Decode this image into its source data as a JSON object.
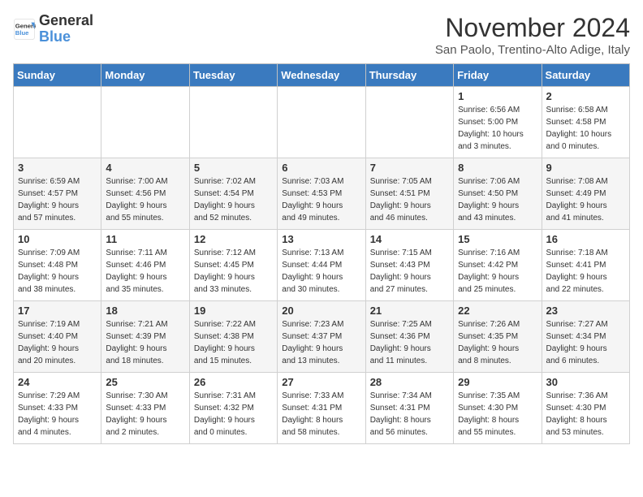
{
  "logo": {
    "line1": "General",
    "line2": "Blue"
  },
  "title": "November 2024",
  "subtitle": "San Paolo, Trentino-Alto Adige, Italy",
  "headers": [
    "Sunday",
    "Monday",
    "Tuesday",
    "Wednesday",
    "Thursday",
    "Friday",
    "Saturday"
  ],
  "weeks": [
    [
      {
        "day": "",
        "info": ""
      },
      {
        "day": "",
        "info": ""
      },
      {
        "day": "",
        "info": ""
      },
      {
        "day": "",
        "info": ""
      },
      {
        "day": "",
        "info": ""
      },
      {
        "day": "1",
        "info": "Sunrise: 6:56 AM\nSunset: 5:00 PM\nDaylight: 10 hours\nand 3 minutes."
      },
      {
        "day": "2",
        "info": "Sunrise: 6:58 AM\nSunset: 4:58 PM\nDaylight: 10 hours\nand 0 minutes."
      }
    ],
    [
      {
        "day": "3",
        "info": "Sunrise: 6:59 AM\nSunset: 4:57 PM\nDaylight: 9 hours\nand 57 minutes."
      },
      {
        "day": "4",
        "info": "Sunrise: 7:00 AM\nSunset: 4:56 PM\nDaylight: 9 hours\nand 55 minutes."
      },
      {
        "day": "5",
        "info": "Sunrise: 7:02 AM\nSunset: 4:54 PM\nDaylight: 9 hours\nand 52 minutes."
      },
      {
        "day": "6",
        "info": "Sunrise: 7:03 AM\nSunset: 4:53 PM\nDaylight: 9 hours\nand 49 minutes."
      },
      {
        "day": "7",
        "info": "Sunrise: 7:05 AM\nSunset: 4:51 PM\nDaylight: 9 hours\nand 46 minutes."
      },
      {
        "day": "8",
        "info": "Sunrise: 7:06 AM\nSunset: 4:50 PM\nDaylight: 9 hours\nand 43 minutes."
      },
      {
        "day": "9",
        "info": "Sunrise: 7:08 AM\nSunset: 4:49 PM\nDaylight: 9 hours\nand 41 minutes."
      }
    ],
    [
      {
        "day": "10",
        "info": "Sunrise: 7:09 AM\nSunset: 4:48 PM\nDaylight: 9 hours\nand 38 minutes."
      },
      {
        "day": "11",
        "info": "Sunrise: 7:11 AM\nSunset: 4:46 PM\nDaylight: 9 hours\nand 35 minutes."
      },
      {
        "day": "12",
        "info": "Sunrise: 7:12 AM\nSunset: 4:45 PM\nDaylight: 9 hours\nand 33 minutes."
      },
      {
        "day": "13",
        "info": "Sunrise: 7:13 AM\nSunset: 4:44 PM\nDaylight: 9 hours\nand 30 minutes."
      },
      {
        "day": "14",
        "info": "Sunrise: 7:15 AM\nSunset: 4:43 PM\nDaylight: 9 hours\nand 27 minutes."
      },
      {
        "day": "15",
        "info": "Sunrise: 7:16 AM\nSunset: 4:42 PM\nDaylight: 9 hours\nand 25 minutes."
      },
      {
        "day": "16",
        "info": "Sunrise: 7:18 AM\nSunset: 4:41 PM\nDaylight: 9 hours\nand 22 minutes."
      }
    ],
    [
      {
        "day": "17",
        "info": "Sunrise: 7:19 AM\nSunset: 4:40 PM\nDaylight: 9 hours\nand 20 minutes."
      },
      {
        "day": "18",
        "info": "Sunrise: 7:21 AM\nSunset: 4:39 PM\nDaylight: 9 hours\nand 18 minutes."
      },
      {
        "day": "19",
        "info": "Sunrise: 7:22 AM\nSunset: 4:38 PM\nDaylight: 9 hours\nand 15 minutes."
      },
      {
        "day": "20",
        "info": "Sunrise: 7:23 AM\nSunset: 4:37 PM\nDaylight: 9 hours\nand 13 minutes."
      },
      {
        "day": "21",
        "info": "Sunrise: 7:25 AM\nSunset: 4:36 PM\nDaylight: 9 hours\nand 11 minutes."
      },
      {
        "day": "22",
        "info": "Sunrise: 7:26 AM\nSunset: 4:35 PM\nDaylight: 9 hours\nand 8 minutes."
      },
      {
        "day": "23",
        "info": "Sunrise: 7:27 AM\nSunset: 4:34 PM\nDaylight: 9 hours\nand 6 minutes."
      }
    ],
    [
      {
        "day": "24",
        "info": "Sunrise: 7:29 AM\nSunset: 4:33 PM\nDaylight: 9 hours\nand 4 minutes."
      },
      {
        "day": "25",
        "info": "Sunrise: 7:30 AM\nSunset: 4:33 PM\nDaylight: 9 hours\nand 2 minutes."
      },
      {
        "day": "26",
        "info": "Sunrise: 7:31 AM\nSunset: 4:32 PM\nDaylight: 9 hours\nand 0 minutes."
      },
      {
        "day": "27",
        "info": "Sunrise: 7:33 AM\nSunset: 4:31 PM\nDaylight: 8 hours\nand 58 minutes."
      },
      {
        "day": "28",
        "info": "Sunrise: 7:34 AM\nSunset: 4:31 PM\nDaylight: 8 hours\nand 56 minutes."
      },
      {
        "day": "29",
        "info": "Sunrise: 7:35 AM\nSunset: 4:30 PM\nDaylight: 8 hours\nand 55 minutes."
      },
      {
        "day": "30",
        "info": "Sunrise: 7:36 AM\nSunset: 4:30 PM\nDaylight: 8 hours\nand 53 minutes."
      }
    ]
  ]
}
